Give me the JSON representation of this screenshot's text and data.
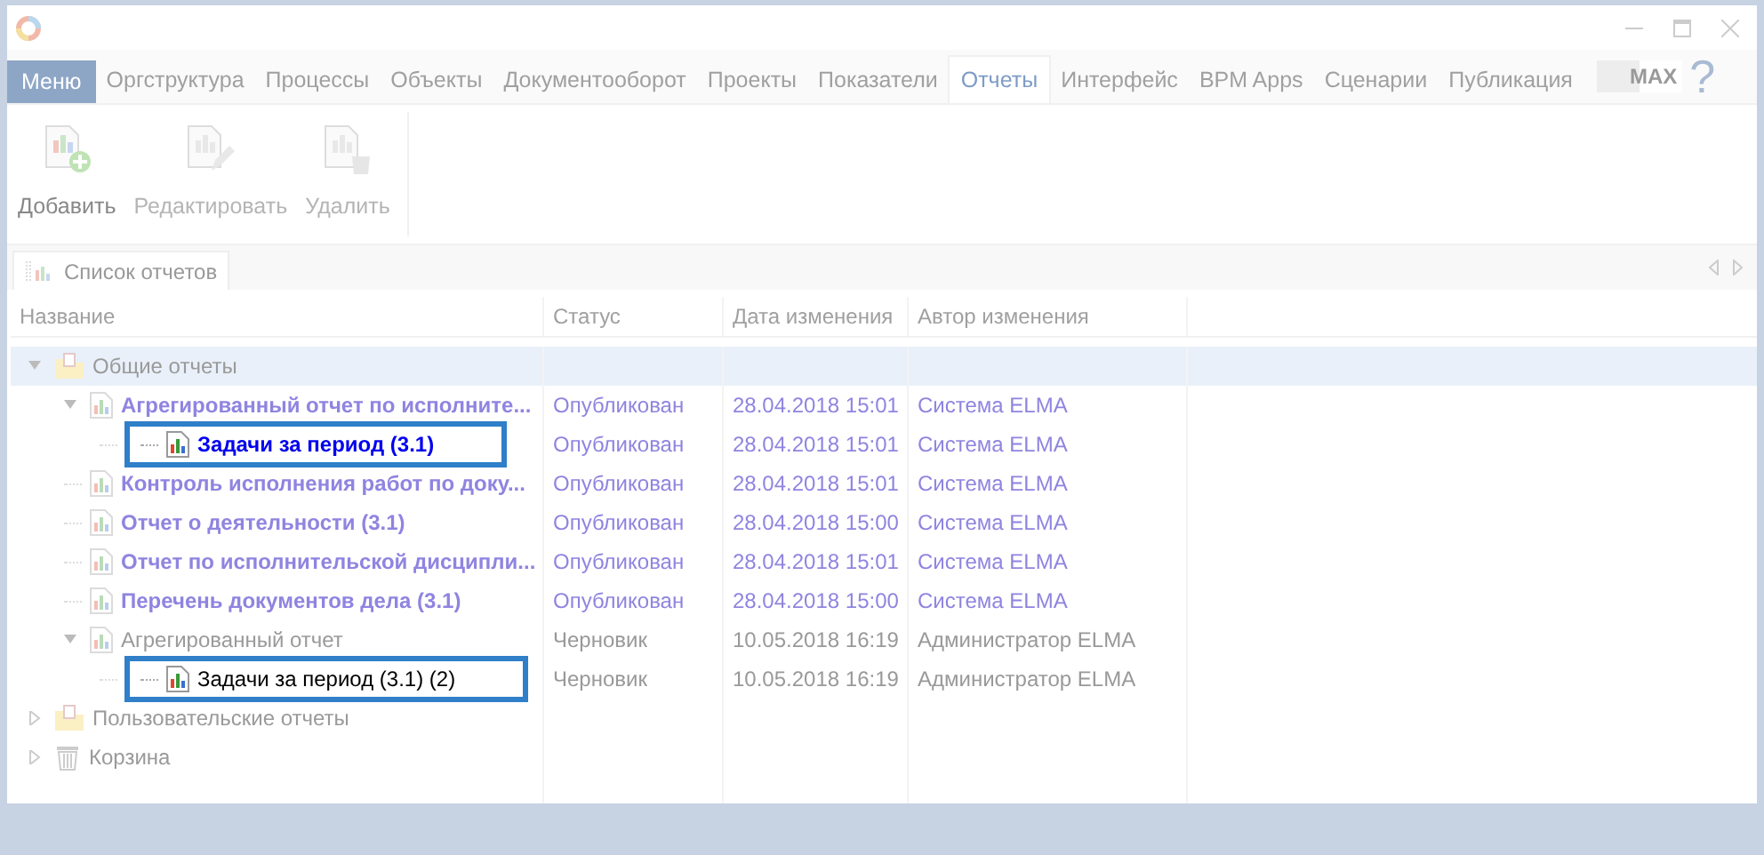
{
  "menu_button": "Меню",
  "menu": [
    {
      "label": "Оргструктура",
      "selected": false
    },
    {
      "label": "Процессы",
      "selected": false
    },
    {
      "label": "Объекты",
      "selected": false
    },
    {
      "label": "Документооборот",
      "selected": false
    },
    {
      "label": "Проекты",
      "selected": false
    },
    {
      "label": "Показатели",
      "selected": false
    },
    {
      "label": "Отчеты",
      "selected": true
    },
    {
      "label": "Интерфейс",
      "selected": false
    },
    {
      "label": "BPM Apps",
      "selected": false
    },
    {
      "label": "Сценарии",
      "selected": false
    },
    {
      "label": "Публикация",
      "selected": false
    }
  ],
  "max_badge": "MAX",
  "help": "?",
  "toolbar": [
    {
      "label": "Добавить",
      "kind": "add",
      "disabled": false
    },
    {
      "label": "Редактировать",
      "kind": "edit",
      "disabled": true
    },
    {
      "label": "Удалить",
      "kind": "delete",
      "disabled": true
    }
  ],
  "tab": {
    "label": "Список отчетов"
  },
  "table": {
    "columns": [
      "Название",
      "Статус",
      "Дата изменения",
      "Автор изменения"
    ],
    "rows": [
      {
        "kind": "folder",
        "name": "Общие отчеты",
        "expanded": true,
        "selected": true,
        "children": [
          {
            "kind": "report",
            "name": "Агрегированный отчет по исполните...",
            "bold": true,
            "status": "Опубликован",
            "date": "28.04.2018 15:01",
            "author": "Система ELMA",
            "expanded": true,
            "children": [
              {
                "kind": "report",
                "name": "Задачи за период (3.1)",
                "bold": true,
                "highlighted": true,
                "status": "Опубликован",
                "date": "28.04.2018 15:01",
                "author": "Система ELMA"
              }
            ]
          },
          {
            "kind": "report",
            "name": "Контроль исполнения работ по доку...",
            "bold": true,
            "status": "Опубликован",
            "date": "28.04.2018 15:01",
            "author": "Система ELMA"
          },
          {
            "kind": "report",
            "name": "Отчет о деятельности (3.1)",
            "bold": true,
            "status": "Опубликован",
            "date": "28.04.2018 15:00",
            "author": "Система ELMA"
          },
          {
            "kind": "report",
            "name": "Отчет по исполнительской дисципли...",
            "bold": true,
            "status": "Опубликован",
            "date": "28.04.2018 15:01",
            "author": "Система ELMA"
          },
          {
            "kind": "report",
            "name": "Перечень документов дела (3.1)",
            "bold": true,
            "status": "Опубликован",
            "date": "28.04.2018 15:00",
            "author": "Система ELMA"
          },
          {
            "kind": "report",
            "name": "Агрегированный отчет",
            "bold": false,
            "status": "Черновик",
            "date": "10.05.2018 16:19",
            "author": "Администратор ELMA",
            "expanded": true,
            "children": [
              {
                "kind": "report",
                "name": "Задачи за период (3.1) (2)",
                "bold": false,
                "highlighted": true,
                "status": "Черновик",
                "date": "10.05.2018 16:19",
                "author": "Администратор ELMA"
              }
            ]
          }
        ]
      },
      {
        "kind": "folder",
        "name": "Пользовательские отчеты",
        "expanded": false,
        "selected": false
      },
      {
        "kind": "trash",
        "name": "Корзина",
        "expanded": false,
        "selected": false
      }
    ]
  }
}
